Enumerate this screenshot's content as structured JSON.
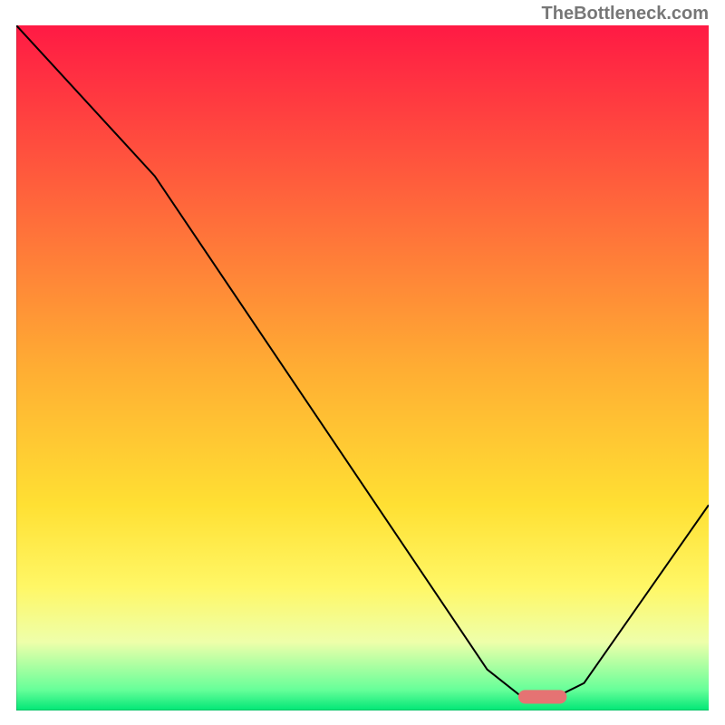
{
  "watermark": "TheBottleneck.com",
  "chart_data": {
    "type": "line",
    "title": "",
    "xlabel": "",
    "ylabel": "",
    "xlim": [
      0,
      100
    ],
    "ylim": [
      0,
      100
    ],
    "gradient_stops": [
      {
        "offset": 0.0,
        "color": "#ff1a44"
      },
      {
        "offset": 0.5,
        "color": "#ffad33"
      },
      {
        "offset": 0.7,
        "color": "#ffe033"
      },
      {
        "offset": 0.82,
        "color": "#fff766"
      },
      {
        "offset": 0.9,
        "color": "#eeffaa"
      },
      {
        "offset": 0.97,
        "color": "#66ff99"
      },
      {
        "offset": 1.0,
        "color": "#00e676"
      }
    ],
    "series": [
      {
        "name": "bottleneck-curve",
        "color": "#000000",
        "x": [
          0,
          20,
          68,
          73,
          78,
          82,
          100
        ],
        "y": [
          100,
          78,
          6,
          2,
          2,
          4,
          30
        ]
      }
    ],
    "marker": {
      "name": "optimal-point",
      "x": 76,
      "y": 2,
      "color": "#e57373",
      "width": 7,
      "height": 2
    }
  }
}
